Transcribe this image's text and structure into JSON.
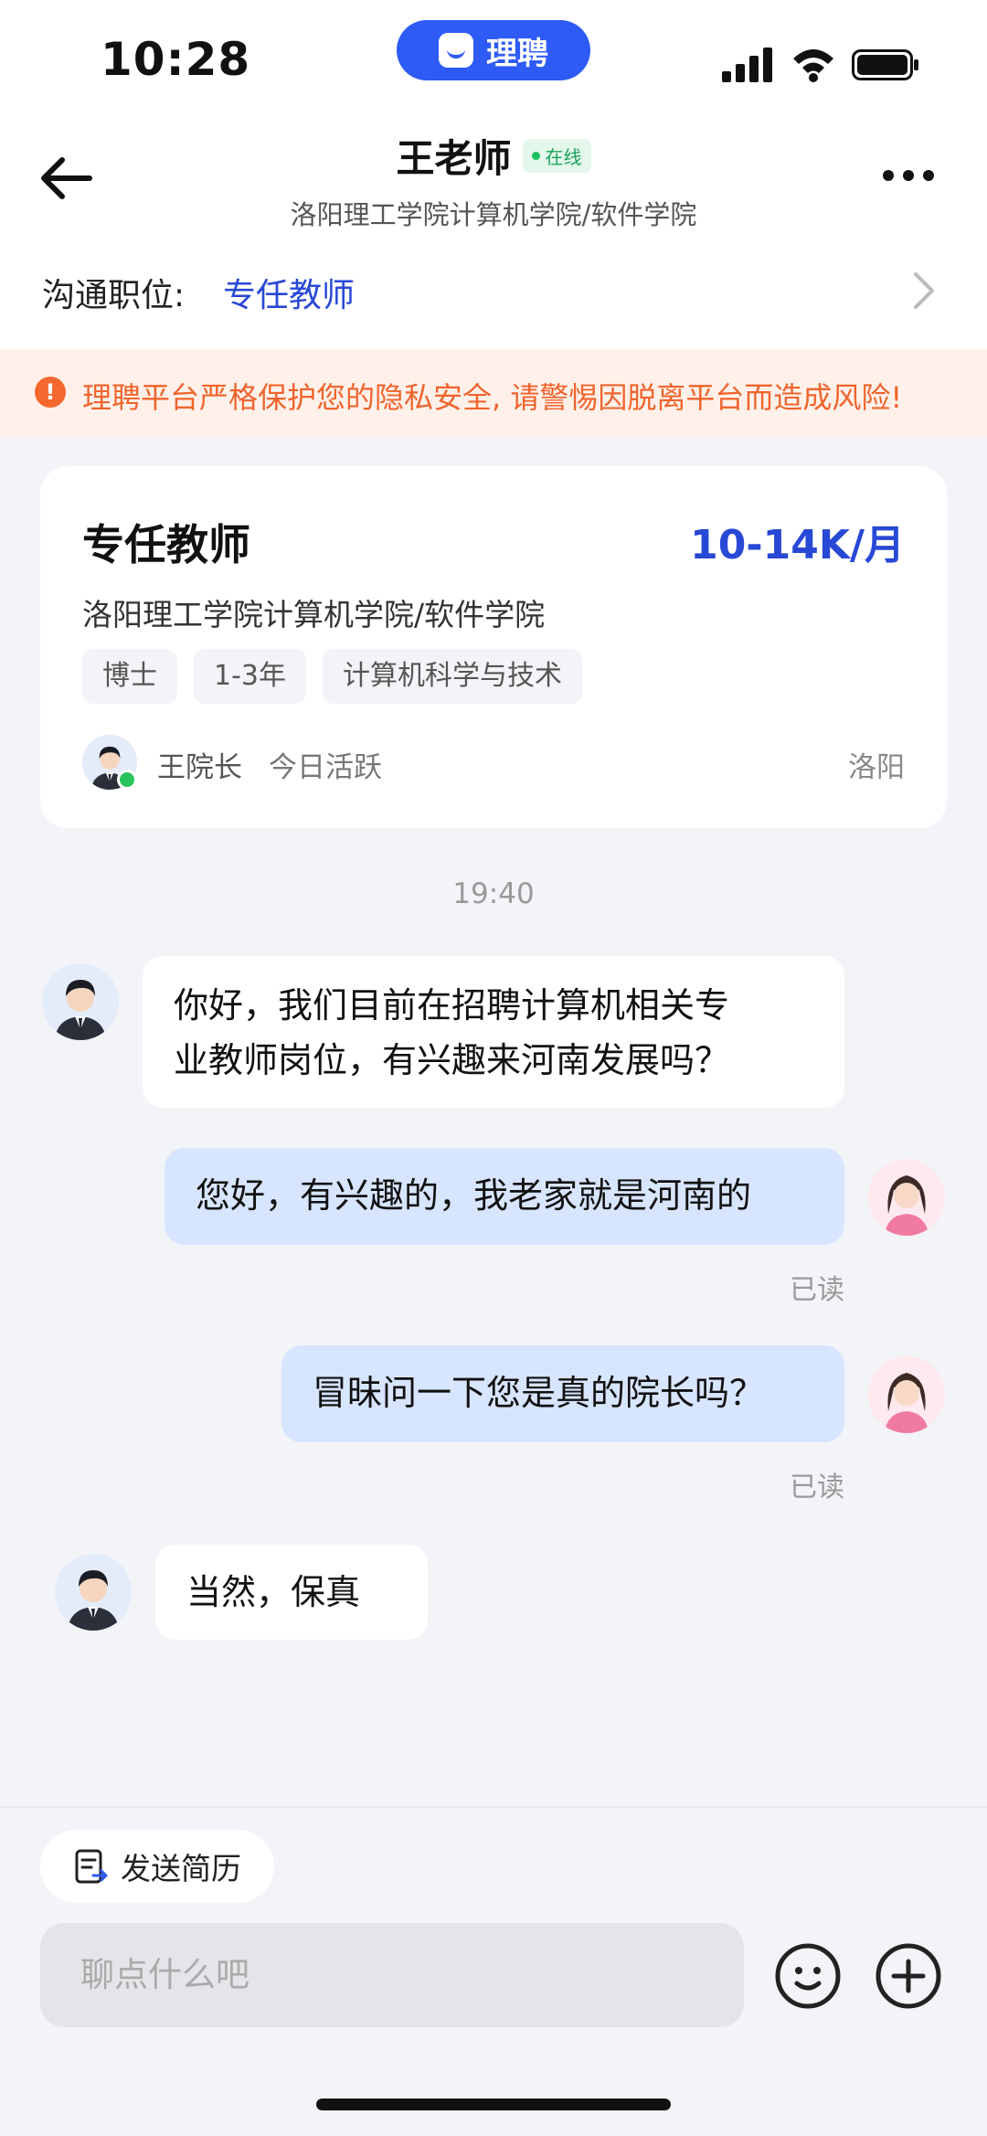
{
  "status_bar": {
    "time": "10:28",
    "app_pill": "理聘"
  },
  "header": {
    "title": "王老师",
    "online_badge": "在线",
    "subtitle": "洛阳理工学院计算机学院/软件学院"
  },
  "position": {
    "label": "沟通职位:",
    "value": "专任教师"
  },
  "warning": {
    "text": "理聘平台严格保护您的隐私安全, 请警惕因脱离平台而造成风险!"
  },
  "job_card": {
    "title": "专任教师",
    "salary": "10-14K/月",
    "school": "洛阳理工学院计算机学院/软件学院",
    "tags": [
      "博士",
      "1-3年",
      "计算机科学与技术"
    ],
    "recruiter_name": "王院长",
    "recruiter_status": "今日活跃",
    "city": "洛阳"
  },
  "chat": {
    "timestamp": "19:40",
    "messages": [
      {
        "side": "in",
        "line1": "你好，我们目前在招聘计算机相关专",
        "line2": "业教师岗位，有兴趣来河南发展吗？"
      },
      {
        "side": "out",
        "text": "您好，有兴趣的，我老家就是河南的",
        "status": "已读"
      },
      {
        "side": "out",
        "text": "冒昧问一下您是真的院长吗？",
        "status": "已读"
      },
      {
        "side": "in",
        "text": "当然，保真"
      }
    ]
  },
  "bottom": {
    "send_resume": "发送简历",
    "input_placeholder": "聊点什么吧"
  },
  "colors": {
    "brand_blue": "#2e5bf5",
    "salary_blue": "#2848d6",
    "warning_orange": "#f0642c",
    "online_green": "#1dbf5f",
    "outgoing_bubble": "#d7e5ff"
  },
  "icons": [
    "back-arrow-icon",
    "more-icon",
    "chevron-right-icon",
    "warning-icon",
    "resume-icon",
    "emoji-icon",
    "plus-icon",
    "signal-icon",
    "wifi-icon",
    "battery-icon"
  ]
}
